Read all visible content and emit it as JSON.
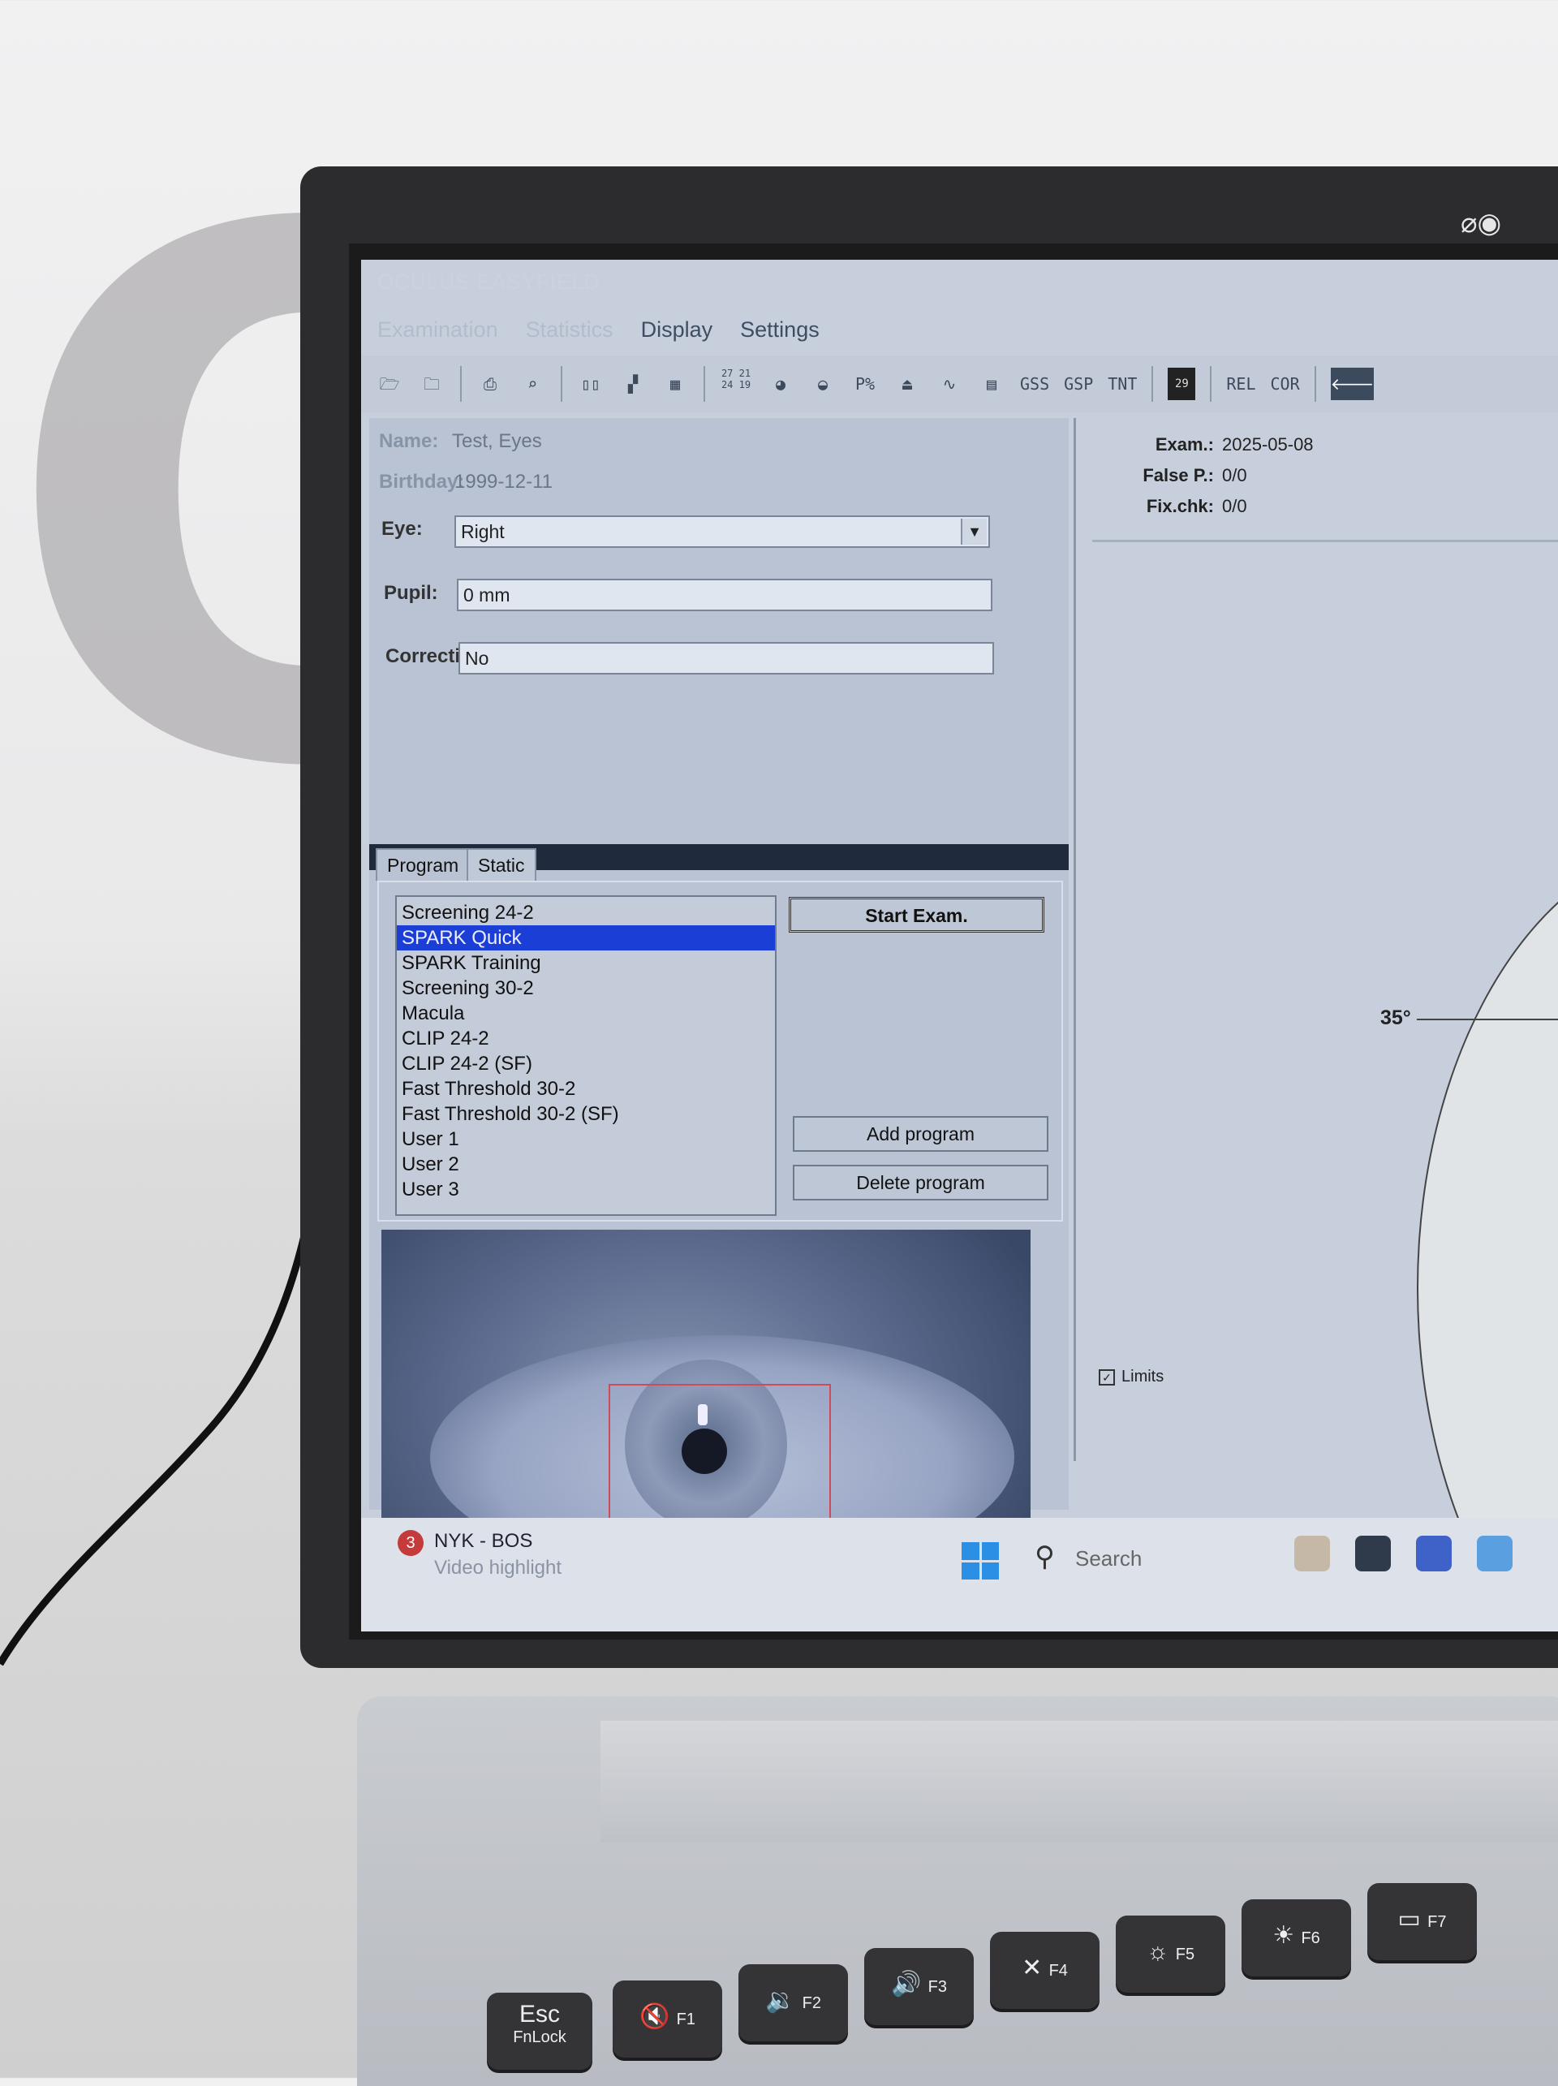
{
  "window": {
    "app_title": "OCULUS EASYFIELD"
  },
  "menu": {
    "items": [
      {
        "label": "Examination",
        "dim": true
      },
      {
        "label": "Statistics",
        "dim": true
      },
      {
        "label": "Display",
        "dim": false
      },
      {
        "label": "Settings",
        "dim": false
      }
    ]
  },
  "toolbar": {
    "grid_numbers": "27 21 24 19",
    "p_percent": "P%",
    "gss": "GSS",
    "gsp": "GSP",
    "tnt": "TNT",
    "dark_button": "29",
    "rel": "REL",
    "cor": "COR"
  },
  "patient": {
    "name_label": "Name:",
    "name_value": "Test, Eyes",
    "birthday_label": "Birthday:",
    "birthday_value": "1999-12-11",
    "eye_label": "Eye:",
    "eye_value": "Right",
    "pupil_label": "Pupil:",
    "pupil_value": "0 mm",
    "correction_label": "Correction:",
    "correction_value": "No"
  },
  "tabs": {
    "program": "Program",
    "static": "Static"
  },
  "programs": [
    "Screening 24-2",
    "SPARK Quick",
    "SPARK Training",
    "Screening 30-2",
    "Macula",
    "CLIP 24-2",
    "CLIP 24-2 (SF)",
    "Fast Threshold 30-2",
    "Fast Threshold 30-2 (SF)",
    "User 1",
    "User 2",
    "User 3"
  ],
  "selected_program": "SPARK Quick",
  "buttons": {
    "start_exam": "Start Exam.",
    "add_program": "Add program",
    "delete_program": "Delete program"
  },
  "exam_info": {
    "exam_label": "Exam.:",
    "exam_value": "2025-05-08",
    "false_p_label": "False P.:",
    "false_p_value": "0/0",
    "fixchk_label": "Fix.chk:",
    "fixchk_value": "0/0"
  },
  "field_plot": {
    "degree_label": "35°",
    "limits_label": "Limits",
    "limits_checked": true
  },
  "taskbar": {
    "notification_count": "3",
    "notification_title": "NYK - BOS",
    "notification_sub": "Video highlight",
    "search_label": "Search"
  },
  "keyboard": {
    "esc": "Esc",
    "fnlock": "FnLock",
    "f1": "F1",
    "f2": "F2",
    "f3": "F3",
    "f4": "F4",
    "f5": "F5",
    "f6": "F6",
    "f7": "F7"
  },
  "colors": {
    "selection": "#1b3fd6",
    "panel": "#b9c3d3",
    "camera_box": "#d04a5a"
  }
}
